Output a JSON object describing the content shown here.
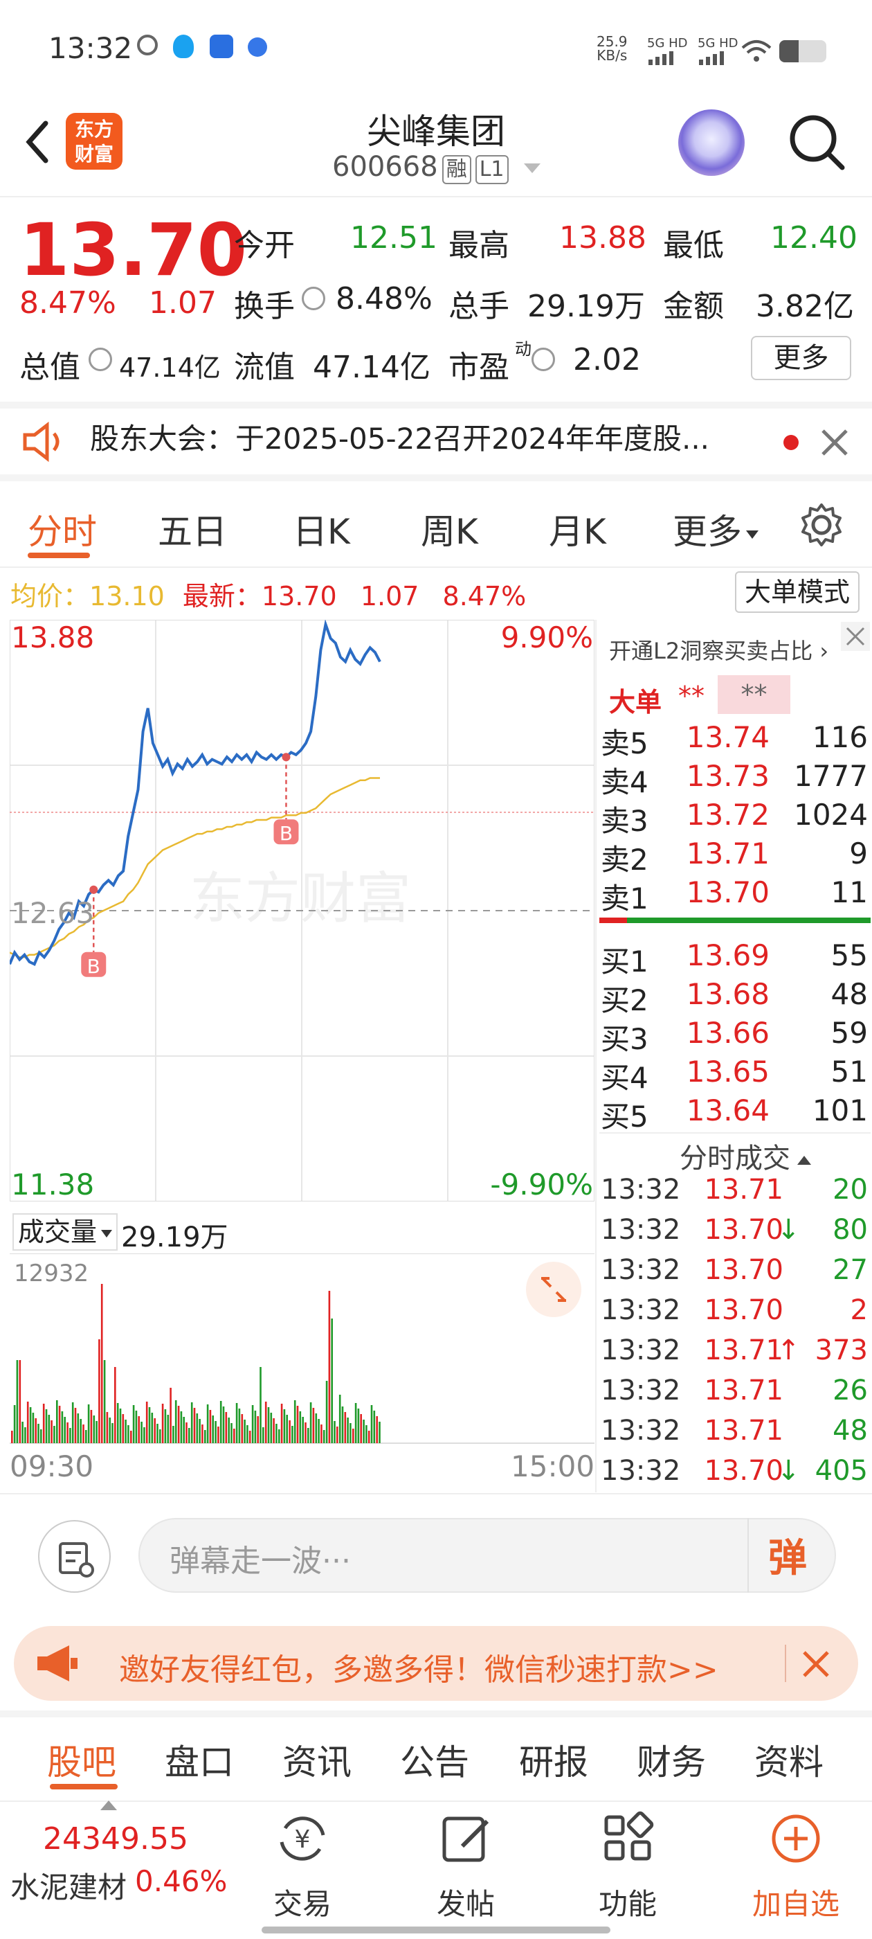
{
  "status_bar": {
    "time": "13:32",
    "net_speed_value": "25.9",
    "net_speed_unit": "KB/s",
    "sig1": "5G HD",
    "sig2": "5G HD"
  },
  "header": {
    "logo_text_1": "东方",
    "logo_text_2": "财富",
    "title": "尖峰集团",
    "code": "600668",
    "tag_margin": "融",
    "tag_level": "L1"
  },
  "quote": {
    "price": "13.70",
    "change_pct": "8.47%",
    "change": "1.07",
    "open_label": "今开",
    "open": "12.51",
    "high_label": "最高",
    "high": "13.88",
    "low_label": "最低",
    "low": "12.40",
    "turnover_label": "换手",
    "turnover": "8.48%",
    "volume_label": "总手",
    "volume": "29.19万",
    "amount_label": "金额",
    "amount": "3.82亿",
    "mcap_label": "总值",
    "mcap": "47.14亿",
    "float_label": "流值",
    "float": "47.14亿",
    "pe_label": "市盈",
    "pe_sup": "动",
    "pe": "2.02",
    "more": "更多"
  },
  "notice": {
    "text": "股东大会：于2025-05-22召开2024年年度股..."
  },
  "tabs": [
    "分时",
    "五日",
    "日K",
    "周K",
    "月K",
    "更多"
  ],
  "chart_info": {
    "avg_label": "均价：",
    "avg": "13.10",
    "latest_label": "最新：",
    "latest": "13.70",
    "latest_chg": "1.07",
    "latest_pct": "8.47%",
    "big_mode": "大单模式"
  },
  "chart_data": {
    "type": "line",
    "y_top": "13.88",
    "y_mid": "12.63",
    "y_bottom": "11.38",
    "pct_top": "9.90%",
    "pct_bottom": "-9.90%",
    "ylim": [
      11.38,
      13.88
    ],
    "watermark": "东方财富",
    "x_start": "09:30",
    "x_end": "15:00",
    "markers": [
      "B",
      "B"
    ],
    "series": [
      {
        "values": [
          12.4,
          12.45,
          12.42,
          12.44,
          12.41,
          12.4,
          12.45,
          12.43,
          12.46,
          12.5,
          12.55,
          12.58,
          12.62,
          12.6,
          12.67,
          12.65,
          12.7,
          12.72,
          12.71,
          12.74,
          12.76,
          12.74,
          12.78,
          12.8,
          12.95,
          13.05,
          13.15,
          13.4,
          13.5,
          13.35,
          13.3,
          13.25,
          13.28,
          13.22,
          13.26,
          13.24,
          13.28,
          13.25,
          13.27,
          13.3,
          13.26,
          13.28,
          13.27,
          13.26,
          13.29,
          13.27,
          13.3,
          13.28,
          13.3,
          13.27,
          13.31,
          13.29,
          13.28,
          13.3,
          13.28,
          13.3,
          13.29,
          13.31,
          13.3,
          13.32,
          13.35,
          13.4,
          13.55,
          13.75,
          13.86,
          13.8,
          13.78,
          13.72,
          13.7,
          13.75,
          13.71,
          13.69,
          13.73,
          13.76,
          13.74,
          13.7
        ]
      },
      {
        "values": [
          12.45,
          12.44,
          12.43,
          12.43,
          12.44,
          12.44,
          12.45,
          12.46,
          12.47,
          12.48,
          12.5,
          12.51,
          12.53,
          12.54,
          12.56,
          12.57,
          12.59,
          12.6,
          12.62,
          12.63,
          12.64,
          12.65,
          12.66,
          12.67,
          12.7,
          12.72,
          12.75,
          12.79,
          12.83,
          12.85,
          12.87,
          12.89,
          12.9,
          12.91,
          12.92,
          12.93,
          12.94,
          12.95,
          12.96,
          12.96,
          12.97,
          12.97,
          12.98,
          12.98,
          12.99,
          12.99,
          13.0,
          13.0,
          13.01,
          13.01,
          13.02,
          13.02,
          13.02,
          13.03,
          13.03,
          13.03,
          13.04,
          13.04,
          13.04,
          13.05,
          13.05,
          13.06,
          13.07,
          13.09,
          13.11,
          13.13,
          13.14,
          13.15,
          13.16,
          13.17,
          13.18,
          13.19,
          13.19,
          13.2,
          13.2,
          13.2
        ]
      }
    ]
  },
  "volume": {
    "label": "成交量",
    "total": "29.19万",
    "max": "12932"
  },
  "orderbook": {
    "link": "开通L2洞察买卖占比 ›",
    "big_label": "大单",
    "big_val1": "**",
    "big_val2": "**",
    "asks": [
      {
        "name": "卖5",
        "price": "13.74",
        "vol": "116"
      },
      {
        "name": "卖4",
        "price": "13.73",
        "vol": "1777"
      },
      {
        "name": "卖3",
        "price": "13.72",
        "vol": "1024"
      },
      {
        "name": "卖2",
        "price": "13.71",
        "vol": "9"
      },
      {
        "name": "卖1",
        "price": "13.70",
        "vol": "11"
      }
    ],
    "bids": [
      {
        "name": "买1",
        "price": "13.69",
        "vol": "55"
      },
      {
        "name": "买2",
        "price": "13.68",
        "vol": "48"
      },
      {
        "name": "买3",
        "price": "13.66",
        "vol": "59"
      },
      {
        "name": "买4",
        "price": "13.65",
        "vol": "51"
      },
      {
        "name": "买5",
        "price": "13.64",
        "vol": "101"
      }
    ],
    "ticks_label": "分时成交",
    "ticks": [
      {
        "t": "13:32",
        "p": "13.71",
        "arrow": "",
        "v": "20",
        "c": "green"
      },
      {
        "t": "13:32",
        "p": "13.70",
        "arrow": "↓",
        "v": "80",
        "c": "green"
      },
      {
        "t": "13:32",
        "p": "13.70",
        "arrow": "",
        "v": "27",
        "c": "green"
      },
      {
        "t": "13:32",
        "p": "13.70",
        "arrow": "",
        "v": "2",
        "c": "red"
      },
      {
        "t": "13:32",
        "p": "13.71",
        "arrow": "↑",
        "v": "373",
        "c": "red"
      },
      {
        "t": "13:32",
        "p": "13.71",
        "arrow": "",
        "v": "26",
        "c": "green"
      },
      {
        "t": "13:32",
        "p": "13.71",
        "arrow": "",
        "v": "48",
        "c": "green"
      },
      {
        "t": "13:32",
        "p": "13.70",
        "arrow": "↓",
        "v": "405",
        "c": "green"
      }
    ]
  },
  "comment": {
    "placeholder": "弹幕走一波···",
    "danmu": "弹"
  },
  "promo": {
    "text": "邀好友得红包，多邀多得！微信秒速打款>>"
  },
  "bottom_tabs": [
    "股吧",
    "盘口",
    "资讯",
    "公告",
    "研报",
    "财务",
    "资料"
  ],
  "bottom_bar": {
    "index_value": "24349.55",
    "index_name": "水泥建材",
    "index_pct": "0.46%",
    "trade": "交易",
    "post": "发帖",
    "func": "功能",
    "add": "加自选"
  },
  "colors": {
    "accent": "#e8602a",
    "up": "#e02222",
    "down": "#1f9a2a",
    "price_line": "#2b6cc4",
    "avg_line": "#e8b931"
  }
}
